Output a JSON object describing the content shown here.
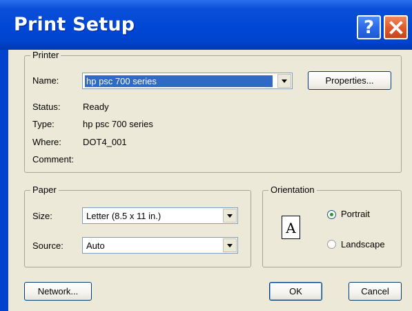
{
  "window": {
    "title": "Print Setup",
    "help_glyph": "?",
    "close_icon": "close-icon"
  },
  "printer": {
    "legend": "Printer",
    "name_label": "Name:",
    "name_value": "hp psc 700 series",
    "properties_button": "Properties...",
    "status_label": "Status:",
    "status_value": "Ready",
    "type_label": "Type:",
    "type_value": "hp psc 700 series",
    "where_label": "Where:",
    "where_value": "DOT4_001",
    "comment_label": "Comment:",
    "comment_value": ""
  },
  "paper": {
    "legend": "Paper",
    "size_label": "Size:",
    "size_value": "Letter (8.5 x 11 in.)",
    "source_label": "Source:",
    "source_value": "Auto"
  },
  "orientation": {
    "legend": "Orientation",
    "icon_letter": "A",
    "portrait_label": "Portrait",
    "landscape_label": "Landscape",
    "selected": "Portrait"
  },
  "buttons": {
    "network": "Network...",
    "ok": "OK",
    "cancel": "Cancel"
  },
  "colors": {
    "titlebar": "#0047d6",
    "dialog_bg": "#ece9d8",
    "selection": "#316ac5",
    "close_button": "#e25a2a"
  }
}
